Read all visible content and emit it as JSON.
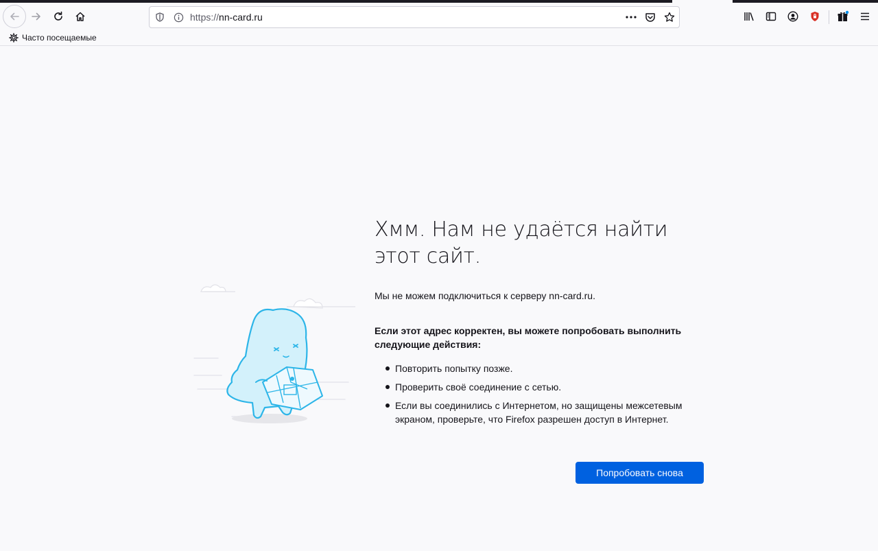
{
  "toolbar": {
    "back_icon": "back-arrow-icon",
    "forward_icon": "forward-arrow-icon",
    "reload_icon": "reload-icon",
    "home_icon": "home-icon",
    "right_icons": [
      "library-icon",
      "sidebar-icon",
      "account-icon",
      "extension-shield-icon",
      "extensions-gift-icon",
      "menu-icon"
    ]
  },
  "urlbar": {
    "protocol": "https://",
    "host": "nn-card.ru",
    "icons": [
      "tracking-shield-icon",
      "site-info-icon",
      "page-actions-icon",
      "pocket-icon",
      "bookmark-star-icon"
    ]
  },
  "bookmarks": {
    "items": [
      {
        "label": "Часто посещаемые",
        "icon": "gear-icon"
      }
    ]
  },
  "error": {
    "title": "Хмм. Нам не удаётся найти этот сайт.",
    "description": "Мы не можем подключиться к серверу nn-card.ru.",
    "suggestions_title": "Если этот адрес корректен, вы можете попробовать выполнить следующие действия:",
    "suggestions": [
      "Повторить попытку позже.",
      "Проверить своё соединение с сетью.",
      "Если вы соединились с Интернетом, но защищены межсетевым экраном, проверьте, что Firefox разрешен доступ в Интернет."
    ],
    "retry_label": "Попробовать снова"
  },
  "colors": {
    "accent": "#0061e0",
    "background": "#f9f9fb",
    "illustration_stroke": "#2cb5e8",
    "illustration_fill": "#d3f1fb"
  }
}
